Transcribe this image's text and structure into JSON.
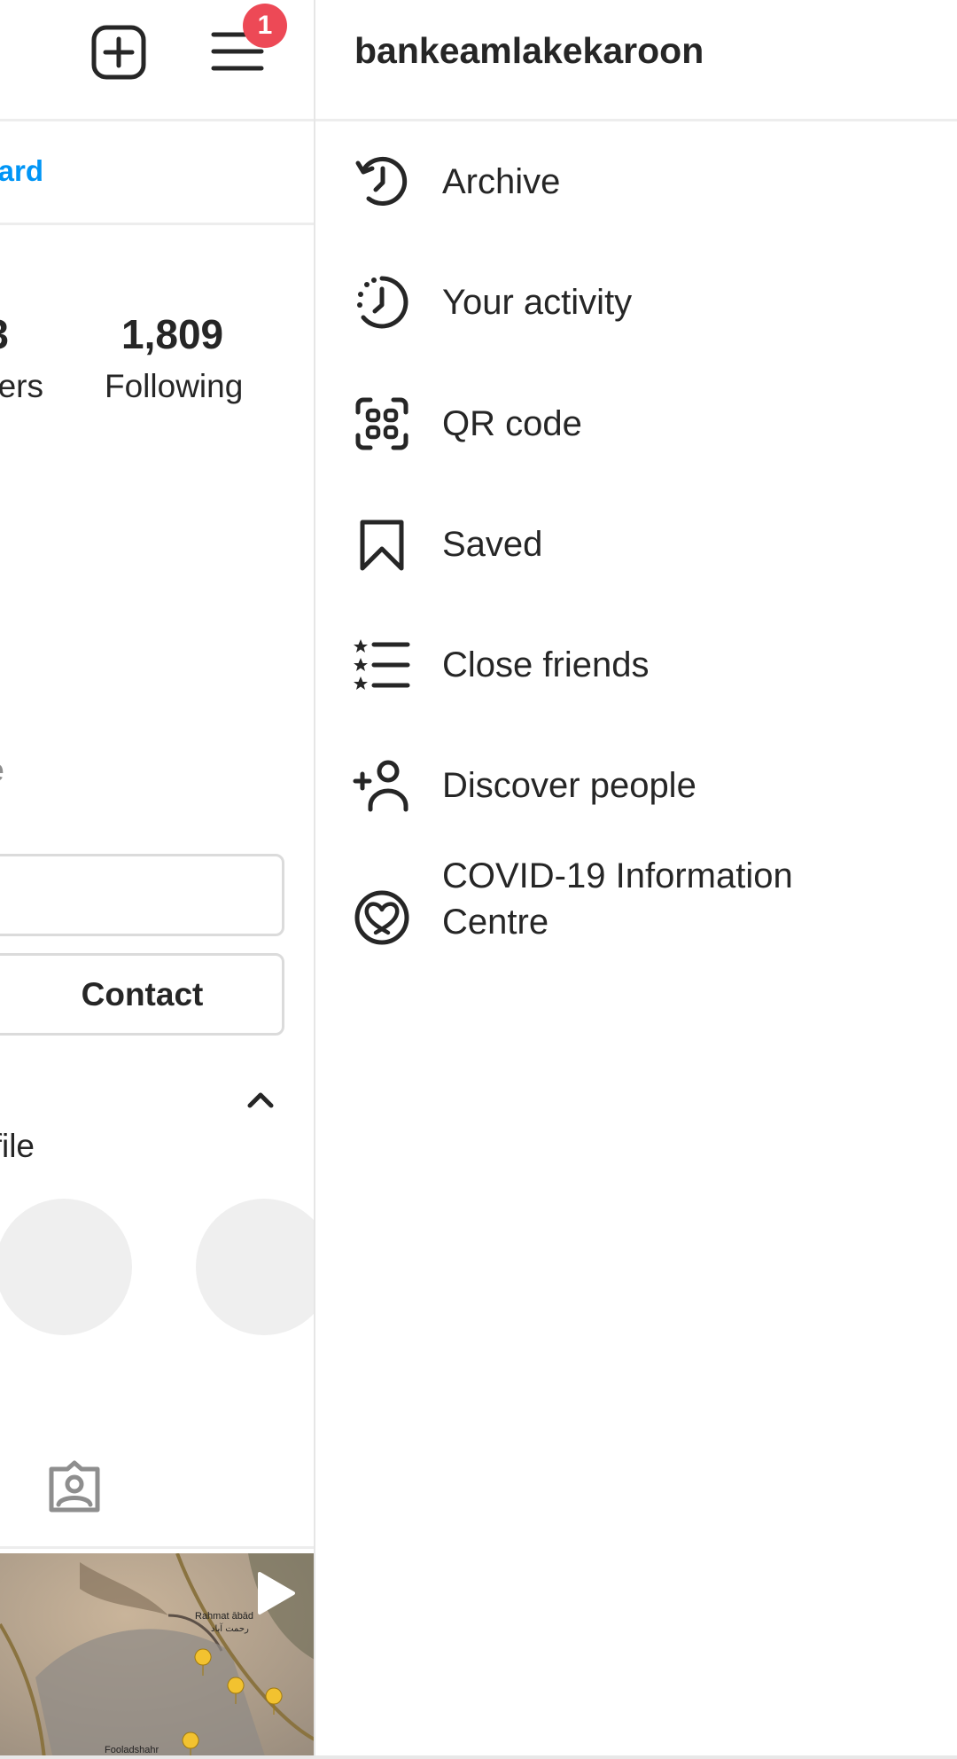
{
  "profile_panel": {
    "header": {
      "new_post_icon": "plus-square-icon",
      "menu_icon": "hamburger-menu-icon",
      "notification_badge_count": "1",
      "badge_color": "#ed4956"
    },
    "dashboard_link_fragment": "ard",
    "link_color": "#0095f6",
    "stats": {
      "followers_number_fragment": "3",
      "followers_label_fragment": "ers",
      "following_number": "1,809",
      "following_label": "Following"
    },
    "grey_text_fragment": "e",
    "contact_button_label": "Contact",
    "suggestions_chevron": "chevron-up-icon",
    "suggestions_text_fragment": "file",
    "tagged_tab_icon": "tagged-contact-icon",
    "post_thumbnail": {
      "map_labels": [
        "Rahmat ābād",
        "رحمت آباد",
        "Fooladshahr"
      ],
      "type_icon": "play-icon"
    }
  },
  "drawer": {
    "username": "bankeamlakekaroon",
    "menu_items": [
      {
        "label": "Archive",
        "icon": "archive-history-icon"
      },
      {
        "label": "Your activity",
        "icon": "activity-clock-icon"
      },
      {
        "label": "QR code",
        "icon": "qr-code-icon"
      },
      {
        "label": "Saved",
        "icon": "bookmark-icon"
      },
      {
        "label": "Close friends",
        "icon": "close-friends-list-icon"
      },
      {
        "label": "Discover people",
        "icon": "add-person-icon"
      },
      {
        "label": "COVID-19 Information",
        "label_line2": "Centre",
        "icon": "covid-heart-icon"
      }
    ]
  }
}
